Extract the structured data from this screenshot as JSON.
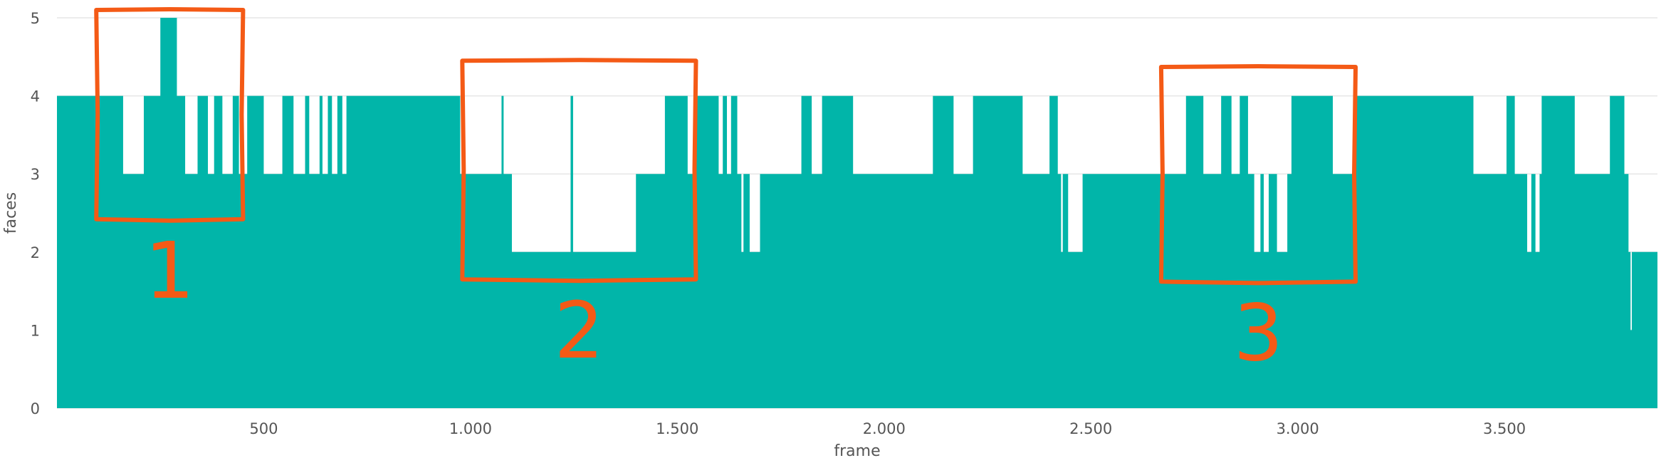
{
  "chart_data": {
    "type": "area",
    "xlabel": "frame",
    "ylabel": "faces",
    "xlim": [
      0,
      3870
    ],
    "ylim": [
      0,
      5
    ],
    "x_ticks": [
      500,
      1000,
      1500,
      2000,
      2500,
      3000,
      3500
    ],
    "x_tick_labels": [
      "500",
      "1.000",
      "1.500",
      "2.000",
      "2.500",
      "3.000",
      "3.500"
    ],
    "y_ticks": [
      0,
      1,
      2,
      3,
      4,
      5
    ],
    "y_tick_labels": [
      "0",
      "1",
      "2",
      "3",
      "4",
      "5"
    ],
    "grid": true,
    "colors": {
      "series": "#01b5a9",
      "annotation": "#f45a16"
    },
    "series": [
      {
        "steps": [
          [
            0,
            4
          ],
          [
            160,
            3
          ],
          [
            210,
            4
          ],
          [
            250,
            5
          ],
          [
            290,
            4
          ],
          [
            310,
            3
          ],
          [
            340,
            4
          ],
          [
            365,
            3
          ],
          [
            380,
            4
          ],
          [
            400,
            3
          ],
          [
            425,
            4
          ],
          [
            440,
            3
          ],
          [
            460,
            4
          ],
          [
            500,
            3
          ],
          [
            545,
            4
          ],
          [
            572,
            3
          ],
          [
            600,
            4
          ],
          [
            610,
            3
          ],
          [
            635,
            4
          ],
          [
            642,
            3
          ],
          [
            655,
            4
          ],
          [
            665,
            3
          ],
          [
            678,
            4
          ],
          [
            690,
            3
          ],
          [
            700,
            4
          ],
          [
            975,
            3
          ],
          [
            1075,
            4
          ],
          [
            1080,
            3
          ],
          [
            1100,
            2
          ],
          [
            1242,
            4
          ],
          [
            1248,
            2
          ],
          [
            1400,
            3
          ],
          [
            1470,
            4
          ],
          [
            1525,
            3
          ],
          [
            1545,
            4
          ],
          [
            1600,
            3
          ],
          [
            1610,
            4
          ],
          [
            1620,
            3
          ],
          [
            1630,
            4
          ],
          [
            1645,
            3
          ],
          [
            1655,
            2
          ],
          [
            1660,
            3
          ],
          [
            1675,
            2
          ],
          [
            1700,
            3
          ],
          [
            1800,
            4
          ],
          [
            1825,
            3
          ],
          [
            1850,
            4
          ],
          [
            1925,
            3
          ],
          [
            2118,
            4
          ],
          [
            2168,
            3
          ],
          [
            2215,
            4
          ],
          [
            2335,
            3
          ],
          [
            2400,
            4
          ],
          [
            2420,
            3
          ],
          [
            2428,
            2
          ],
          [
            2432,
            3
          ],
          [
            2445,
            2
          ],
          [
            2480,
            3
          ],
          [
            2730,
            4
          ],
          [
            2772,
            3
          ],
          [
            2815,
            4
          ],
          [
            2840,
            3
          ],
          [
            2860,
            4
          ],
          [
            2880,
            3
          ],
          [
            2895,
            2
          ],
          [
            2910,
            3
          ],
          [
            2918,
            2
          ],
          [
            2930,
            3
          ],
          [
            2950,
            2
          ],
          [
            2975,
            3
          ],
          [
            2985,
            4
          ],
          [
            3085,
            3
          ],
          [
            3140,
            4
          ],
          [
            3425,
            3
          ],
          [
            3505,
            4
          ],
          [
            3525,
            3
          ],
          [
            3555,
            2
          ],
          [
            3565,
            3
          ],
          [
            3575,
            2
          ],
          [
            3585,
            3
          ],
          [
            3590,
            4
          ],
          [
            3670,
            3
          ],
          [
            3755,
            4
          ],
          [
            3790,
            3
          ],
          [
            3800,
            2
          ],
          [
            3805,
            1
          ],
          [
            3808,
            2
          ],
          [
            3870,
            3
          ]
        ],
        "x_end": 3870
      }
    ],
    "annotations": [
      {
        "label": "1",
        "x_range": [
          95,
          450
        ],
        "y_range": [
          2.42,
          5.1
        ]
      },
      {
        "label": "2",
        "x_range": [
          980,
          1545
        ],
        "y_range": [
          1.65,
          4.45
        ]
      },
      {
        "label": "3",
        "x_range": [
          2670,
          3140
        ],
        "y_range": [
          1.62,
          4.37
        ]
      }
    ]
  }
}
